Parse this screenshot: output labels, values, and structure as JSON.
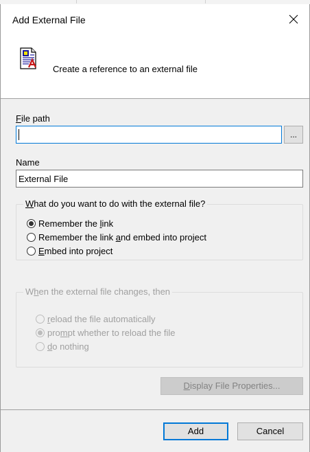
{
  "window": {
    "title": "Add External File",
    "close_glyph": "close-icon"
  },
  "header": {
    "icon": "external-file-icon",
    "text": "Create a reference to an external file"
  },
  "file_path": {
    "label_accel": "F",
    "label_rest": "ile path",
    "value": "",
    "browse_label": "..."
  },
  "name": {
    "label": "Name",
    "value": "External File"
  },
  "action_group": {
    "legend_accel": "W",
    "legend_rest": "hat do you want to do with the external file?",
    "options": [
      {
        "pre": "Remember the ",
        "accel": "l",
        "post": "ink",
        "checked": true
      },
      {
        "pre": "Remember the link ",
        "accel": "a",
        "post": "nd embed into project",
        "checked": false
      },
      {
        "pre": "",
        "accel": "E",
        "post": "mbed into project",
        "checked": false
      }
    ]
  },
  "change_group": {
    "legend_pre": "W",
    "legend_accel": "h",
    "legend_post": "en the external file changes, then",
    "disabled": true,
    "options": [
      {
        "pre": "",
        "accel": "r",
        "post": "eload the file automatically",
        "checked": false
      },
      {
        "pre": "pro",
        "accel": "m",
        "post": "pt whether to reload the file",
        "checked": true
      },
      {
        "pre": "",
        "accel": "d",
        "post": "o nothing",
        "checked": false
      }
    ]
  },
  "display_props_button": {
    "accel": "D",
    "rest": "isplay File Properties...",
    "disabled": true
  },
  "footer": {
    "add_label": "Add",
    "cancel_label": "Cancel"
  },
  "colors": {
    "accent": "#0078d7",
    "dialog_bg": "#f0f0f0",
    "disabled_text": "#a0a0a0"
  }
}
